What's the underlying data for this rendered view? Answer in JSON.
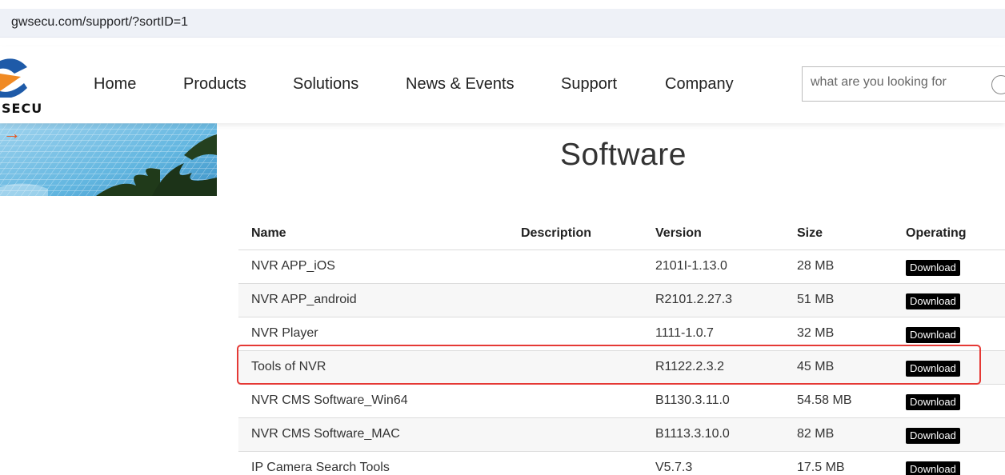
{
  "browser": {
    "url": "gwsecu.com/support/?sortID=1"
  },
  "brand": {
    "logo_text": "SECU"
  },
  "nav": {
    "items": [
      {
        "label": "Home"
      },
      {
        "label": "Products"
      },
      {
        "label": "Solutions"
      },
      {
        "label": "News & Events"
      },
      {
        "label": "Support"
      },
      {
        "label": "Company"
      }
    ]
  },
  "search": {
    "placeholder": "what are you looking for",
    "icon": "search-icon"
  },
  "banner": {
    "arrow_icon": "arrow-right-icon",
    "arrow_glyph": "→"
  },
  "page": {
    "title": "Software"
  },
  "table": {
    "headers": {
      "name": "Name",
      "description": "Description",
      "version": "Version",
      "size": "Size",
      "operating": "Operating"
    },
    "rows": [
      {
        "name": "NVR APP_iOS",
        "description": "",
        "version": "2101I-1.13.0",
        "size": "28 MB",
        "action": "Download"
      },
      {
        "name": "NVR APP_android",
        "description": "",
        "version": "R2101.2.27.3",
        "size": "51 MB",
        "action": "Download"
      },
      {
        "name": "NVR Player",
        "description": "",
        "version": "1111-1.0.7",
        "size": "32 MB",
        "action": "Download"
      },
      {
        "name": "Tools of NVR",
        "description": "",
        "version": "R1122.2.3.2",
        "size": "45 MB",
        "action": "Download"
      },
      {
        "name": "NVR CMS Software_Win64",
        "description": "",
        "version": "B1130.3.11.0",
        "size": "54.58 MB",
        "action": "Download"
      },
      {
        "name": "NVR CMS Software_MAC",
        "description": "",
        "version": "B1113.3.10.0",
        "size": "82 MB",
        "action": "Download"
      },
      {
        "name": "IP Camera Search Tools",
        "description": "",
        "version": "V5.7.3",
        "size": "17.5 MB",
        "action": "Download"
      }
    ]
  },
  "colors": {
    "highlight": "#e53935",
    "accent_arrow": "#e8551e",
    "button_bg": "#000000",
    "logo_blue": "#1e5aa8",
    "logo_orange": "#f08a24"
  }
}
